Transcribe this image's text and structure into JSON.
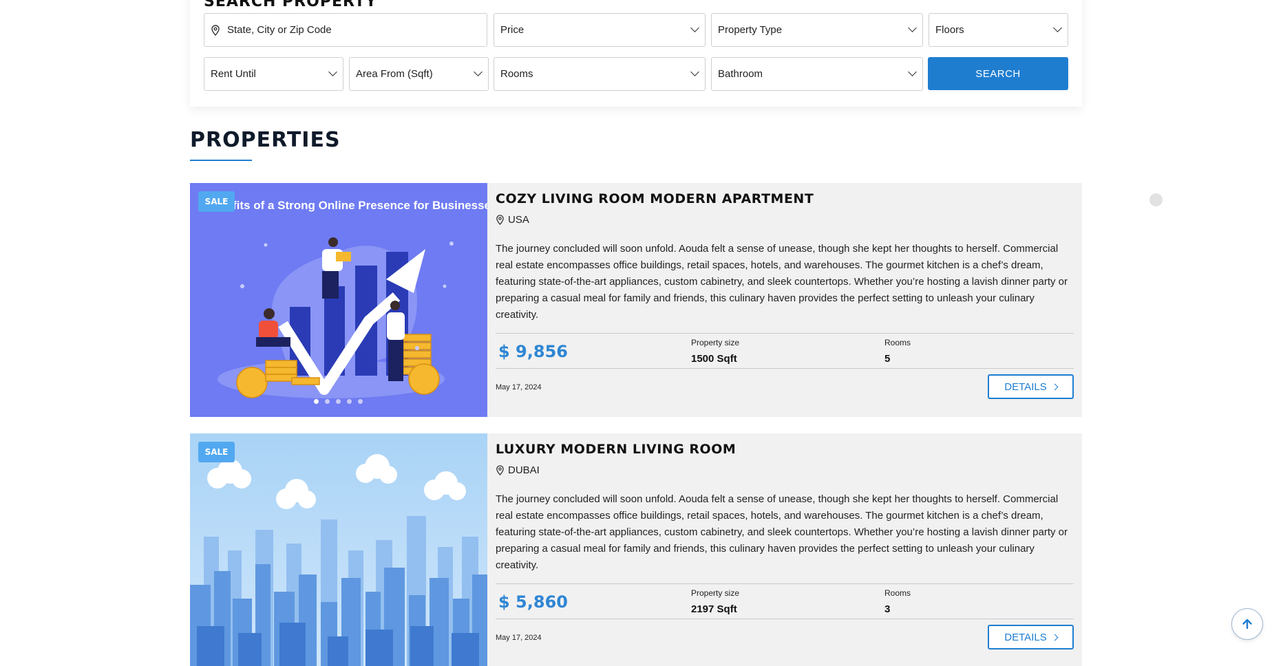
{
  "search": {
    "title": "SEARCH PROPERTY",
    "location_placeholder": "State, City or Zip Code",
    "price": "Price",
    "property_type": "Property Type",
    "floors": "Floors",
    "rent_until": "Rent Until",
    "area_from": "Area From (Sqft)",
    "rooms": "Rooms",
    "bathroom": "Bathroom",
    "button": "SEARCH"
  },
  "section": {
    "title": "PROPERTIES"
  },
  "properties": [
    {
      "badge": "SALE",
      "image_caption": "fits of a Strong Online Presence for Businesses",
      "title": "COZY LIVING ROOM MODERN APARTMENT",
      "location": "USA",
      "description": "The journey concluded will soon unfold. Aouda felt a sense of unease, though she kept her thoughts to herself. Commercial real estate encompasses office buildings, retail spaces, hotels, and warehouses. The gourmet kitchen is a chef’s dream, featuring state-of-the-art appliances, custom cabinetry, and sleek countertops. Whether you’re hosting a lavish dinner party or preparing a casual meal for family and friends, this culinary haven provides the perfect setting to unleash your culinary creativity.",
      "price": "$ 9,856",
      "size_label": "Property size",
      "size_value": "1500 Sqft",
      "rooms_label": "Rooms",
      "rooms_value": "5",
      "date": "May 17, 2024",
      "details": "DETAILS"
    },
    {
      "badge": "SALE",
      "title": "LUXURY MODERN LIVING ROOM",
      "location": "DUBAI",
      "description": "The journey concluded will soon unfold. Aouda felt a sense of unease, though she kept her thoughts to herself. Commercial real estate encompasses office buildings, retail spaces, hotels, and warehouses. The gourmet kitchen is a chef’s dream, featuring state-of-the-art appliances, custom cabinetry, and sleek countertops. Whether you’re hosting a lavish dinner party or preparing a casual meal for family and friends, this culinary haven provides the perfect setting to unleash your culinary creativity.",
      "price": "$ 5,860",
      "size_label": "Property size",
      "size_value": "2197 Sqft",
      "rooms_label": "Rooms",
      "rooms_value": "3",
      "date": "May 17, 2024",
      "details": "DETAILS"
    }
  ],
  "colors": {
    "accent": "#1f7dd0",
    "price": "#2f86d4",
    "badge": "#52a8f0",
    "card_bg": "#f1f1f1"
  }
}
